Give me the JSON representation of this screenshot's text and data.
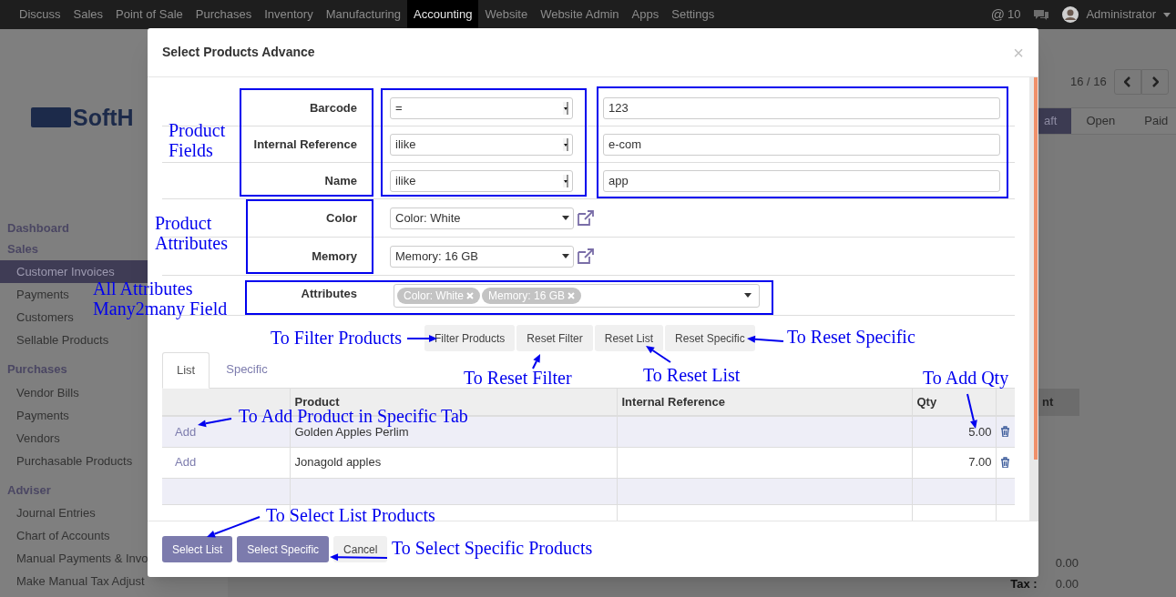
{
  "navbar": {
    "menu": [
      {
        "label": "Discuss",
        "selected": false
      },
      {
        "label": "Sales",
        "selected": false
      },
      {
        "label": "Point of Sale",
        "selected": false
      },
      {
        "label": "Purchases",
        "selected": false
      },
      {
        "label": "Inventory",
        "selected": false
      },
      {
        "label": "Manufacturing",
        "selected": false
      },
      {
        "label": "Accounting",
        "selected": true
      },
      {
        "label": "Website",
        "selected": false
      },
      {
        "label": "Website Admin",
        "selected": false
      },
      {
        "label": "Apps",
        "selected": false
      },
      {
        "label": "Settings",
        "selected": false
      }
    ],
    "mention_mark": "@",
    "mention_count": "10",
    "user": "Administrator"
  },
  "brand": "SoftH",
  "sidebar": {
    "sections": [
      {
        "title": "Dashboard"
      },
      {
        "title": "Sales",
        "items": [
          {
            "label": "Customer Invoices",
            "selected": true
          },
          {
            "label": "Payments",
            "selected": false
          },
          {
            "label": "Customers",
            "selected": false
          },
          {
            "label": "Sellable Products",
            "selected": false
          }
        ]
      },
      {
        "title": "Purchases",
        "items": [
          {
            "label": "Vendor Bills",
            "selected": false
          },
          {
            "label": "Payments",
            "selected": false
          },
          {
            "label": "Vendors",
            "selected": false
          },
          {
            "label": "Purchasable Products",
            "selected": false
          }
        ]
      },
      {
        "title": "Adviser",
        "items": [
          {
            "label": "Journal Entries",
            "selected": false
          },
          {
            "label": "Chart of Accounts",
            "selected": false
          },
          {
            "label": "Manual Payments & Invo",
            "selected": false
          },
          {
            "label": "Make Manual Tax Adjust",
            "selected": false
          }
        ]
      }
    ]
  },
  "record": {
    "pager": "16 / 16",
    "stages": [
      {
        "label": "aft",
        "selected": true
      },
      {
        "label": "Open",
        "selected": false
      },
      {
        "label": "Paid",
        "selected": false
      }
    ],
    "column_header": "nt",
    "totals": [
      {
        "value": "0.00"
      },
      {
        "label": "Tax :",
        "value": "0.00"
      }
    ]
  },
  "dialog": {
    "title": "Select Products Advance",
    "close": "×",
    "filters": [
      {
        "label": "Barcode",
        "operator": "=",
        "value": "123"
      },
      {
        "label": "Internal Reference",
        "operator": "ilike",
        "value": "e-com"
      },
      {
        "label": "Name",
        "operator": "ilike",
        "value": "app"
      }
    ],
    "attributes": [
      {
        "label": "Color",
        "value": "Color: White"
      },
      {
        "label": "Memory",
        "value": "Memory: 16 GB"
      }
    ],
    "attributes_field": {
      "label": "Attributes",
      "tags": [
        "Color: White",
        "Memory: 16 GB"
      ]
    },
    "actions": [
      "Filter Products",
      "Reset Filter",
      "Reset List",
      "Reset Specific"
    ],
    "tabs": [
      {
        "label": "List",
        "selected": true
      },
      {
        "label": "Specific",
        "selected": false
      }
    ],
    "table": {
      "columns": [
        "Product",
        "Internal Reference",
        "Qty"
      ],
      "rows": [
        {
          "action": "Add",
          "product": "Golden Apples Perlim",
          "qty": "5.00"
        },
        {
          "action": "Add",
          "product": "Jonagold apples",
          "qty": "7.00"
        }
      ]
    },
    "buttons": [
      {
        "label": "Select List",
        "kind": "primary"
      },
      {
        "label": "Select Specific",
        "kind": "primary"
      },
      {
        "label": "Cancel",
        "kind": "secondary"
      }
    ]
  },
  "annotations": [
    {
      "text": "Product Fields"
    },
    {
      "text": "Product Attributes"
    },
    {
      "text": "All Attributes Many2many Field"
    },
    {
      "text": "To Filter Products"
    },
    {
      "text": "To Reset Filter"
    },
    {
      "text": "To Reset List"
    },
    {
      "text": "To Reset Specific"
    },
    {
      "text": "To Add Qty"
    },
    {
      "text": "To Add Product in Specific Tab"
    },
    {
      "text": "To Select List Products"
    },
    {
      "text": "To Select Specific Products"
    }
  ]
}
